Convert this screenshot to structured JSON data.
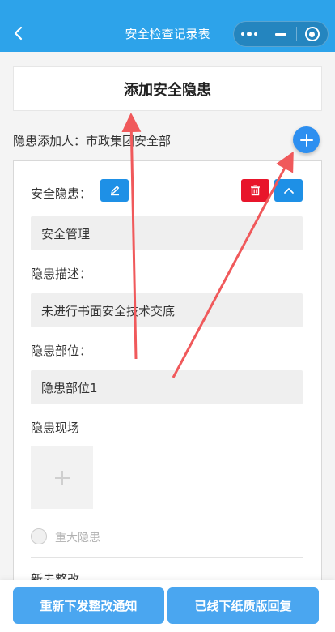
{
  "nav": {
    "title": "安全检查记录表"
  },
  "title_card": {
    "title": "添加安全隐患"
  },
  "adder": {
    "text": "隐患添加人：市政集团安全部"
  },
  "form": {
    "hazard_label": "安全隐患：",
    "hazard_value": "安全管理",
    "desc_label": "隐患描述：",
    "desc_value": "未进行书面安全技术交底",
    "location_label": "隐患部位：",
    "location_value": "隐患部位1",
    "scene_label": "隐患现场",
    "major_label": "重大隐患",
    "rectify_label": "新去整改"
  },
  "bottom": {
    "reissue_label": "重新下发整改通知",
    "offline_label": "已线下纸质版回复"
  },
  "colors": {
    "nav_bg": "#2da3ea",
    "primary": "#1e90e6",
    "danger": "#e8152b",
    "annotation": "#f0595b"
  },
  "icons": [
    "back-icon",
    "more-dots-icon",
    "minimize-icon",
    "close-target-icon",
    "plus-icon",
    "edit-icon",
    "trash-icon",
    "chevron-up-icon"
  ]
}
